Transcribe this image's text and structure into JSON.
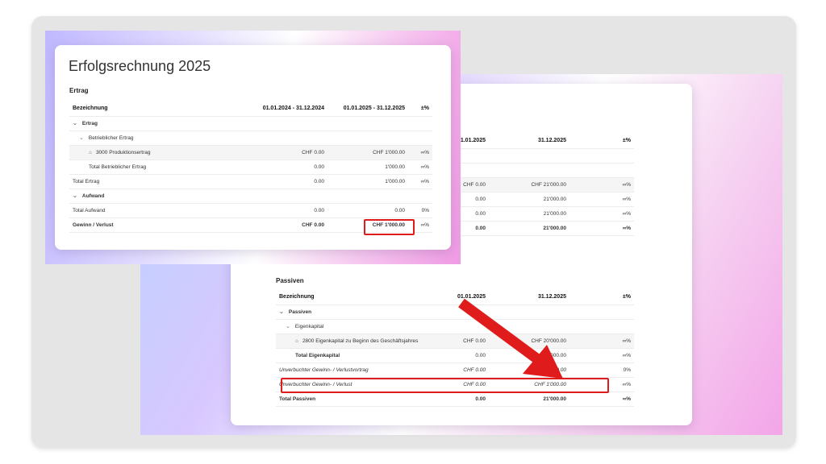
{
  "left_panel": {
    "title": "Erfolgsrechnung 2025",
    "section": "Ertrag",
    "headers": [
      "Bezeichnung",
      "01.01.2024 - 31.12.2024",
      "01.01.2025 - 31.12.2025",
      "±%"
    ],
    "rows": [
      {
        "label": "Ertrag",
        "prev": "",
        "curr": "",
        "pct": ""
      },
      {
        "label": "Betrieblicher Ertrag",
        "prev": "",
        "curr": "",
        "pct": ""
      },
      {
        "label": "3000 Produktionsertrag",
        "prev": "CHF 0.00",
        "curr": "CHF 1'000.00",
        "pct": "∞%"
      },
      {
        "label": "Total Betrieblicher Ertrag",
        "prev": "0.00",
        "curr": "1'000.00",
        "pct": "∞%"
      },
      {
        "label": "Total Ertrag",
        "prev": "0.00",
        "curr": "1'000.00",
        "pct": "∞%"
      },
      {
        "label": "Aufwand",
        "prev": "",
        "curr": "",
        "pct": ""
      },
      {
        "label": "Total Aufwand",
        "prev": "0.00",
        "curr": "0.00",
        "pct": "0%"
      },
      {
        "label": "Gewinn / Verlust",
        "prev": "CHF 0.00",
        "curr": "CHF 1'000.00",
        "pct": "∞%"
      }
    ]
  },
  "right_panel": {
    "top_headers": [
      "01.01.2025",
      "31.12.2025",
      "±%"
    ],
    "top_rows": [
      {
        "prev": "CHF 0.00",
        "curr": "CHF 21'000.00",
        "pct": "∞%"
      },
      {
        "prev": "0.00",
        "curr": "21'000.00",
        "pct": "∞%"
      },
      {
        "prev": "0.00",
        "curr": "21'000.00",
        "pct": "∞%"
      },
      {
        "prev": "0.00",
        "curr": "21'000.00",
        "pct": "∞%"
      }
    ],
    "section": "Passiven",
    "headers": [
      "Bezeichnung",
      "01.01.2025",
      "31.12.2025",
      "±%"
    ],
    "rows": [
      {
        "label": "Passiven",
        "prev": "",
        "curr": "",
        "pct": ""
      },
      {
        "label": "Eigenkapital",
        "prev": "",
        "curr": "",
        "pct": ""
      },
      {
        "label": "2800 Eigenkapital zu Beginn des Geschäftsjahres",
        "prev": "CHF 0.00",
        "curr": "CHF 20'000.00",
        "pct": "∞%"
      },
      {
        "label": "Total Eigenkapital",
        "prev": "0.00",
        "curr": "20'000.00",
        "pct": "∞%"
      },
      {
        "label": "Unverbuchter Gewinn- / Verlustvortrag",
        "prev": "CHF 0.00",
        "curr": "CHF 0.00",
        "pct": "0%"
      },
      {
        "label": "Unverbuchter Gewinn- / Verlust",
        "prev": "CHF 0.00",
        "curr": "CHF 1'000.00",
        "pct": "∞%"
      },
      {
        "label": "Total Passiven",
        "prev": "0.00",
        "curr": "21'000.00",
        "pct": "∞%"
      }
    ]
  },
  "colors": {
    "highlight": "#e01b1b",
    "arrow": "#e01b1b"
  },
  "icons": {
    "expand": "chevron-down-icon",
    "account": "bank-icon"
  }
}
